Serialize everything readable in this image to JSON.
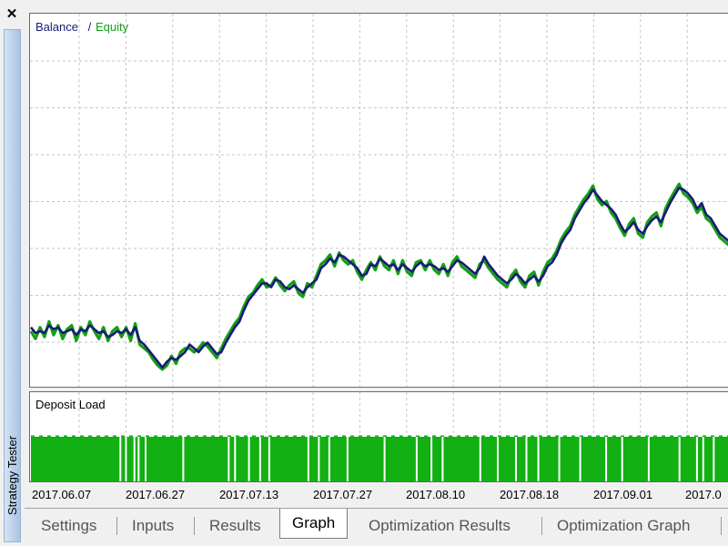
{
  "window": {
    "close_glyph": "✕",
    "side_title": "Strategy Tester"
  },
  "tabs": [
    {
      "label": "Settings",
      "active": false
    },
    {
      "label": "Inputs",
      "active": false
    },
    {
      "label": "Results",
      "active": false
    },
    {
      "label": "Graph",
      "active": true
    },
    {
      "label": "Optimization Results",
      "active": false
    },
    {
      "label": "Optimization Graph",
      "active": false
    }
  ],
  "chart_data": [
    {
      "type": "line",
      "panel": "main",
      "legend": {
        "balance_label": "Balance",
        "separator": " / ",
        "equity_label": "Equity",
        "placement": "top-left"
      },
      "grid": true,
      "colors": {
        "balance": "#1a1a7a",
        "equity": "#12a012",
        "grid": "#c6c6c6",
        "background": "#ffffff"
      },
      "series": [
        {
          "name": "Balance",
          "values": [
            0.23,
            0.2,
            0.21,
            0.2,
            0.24,
            0.22,
            0.23,
            0.2,
            0.21,
            0.22,
            0.19,
            0.22,
            0.21,
            0.24,
            0.22,
            0.2,
            0.21,
            0.18,
            0.19,
            0.21,
            0.2,
            0.22,
            0.19,
            0.23,
            0.16,
            0.14,
            0.11,
            0.08,
            0.05,
            0.02,
            0.05,
            0.07,
            0.06,
            0.08,
            0.1,
            0.14,
            0.12,
            0.1,
            0.13,
            0.15,
            0.12,
            0.09,
            0.1,
            0.15,
            0.19,
            0.23,
            0.26,
            0.32,
            0.37,
            0.4,
            0.43,
            0.46,
            0.46,
            0.44,
            0.48,
            0.47,
            0.44,
            0.43,
            0.45,
            0.43,
            0.41,
            0.44,
            0.46,
            0.48,
            0.54,
            0.56,
            0.59,
            0.57,
            0.61,
            0.6,
            0.58,
            0.56,
            0.54,
            0.5,
            0.51,
            0.56,
            0.55,
            0.59,
            0.57,
            0.55,
            0.56,
            0.53,
            0.56,
            0.54,
            0.52,
            0.55,
            0.57,
            0.55,
            0.56,
            0.55,
            0.53,
            0.54,
            0.52,
            0.55,
            0.58,
            0.57,
            0.55,
            0.53,
            0.51,
            0.54,
            0.6,
            0.56,
            0.53,
            0.5,
            0.48,
            0.46,
            0.48,
            0.51,
            0.49,
            0.46,
            0.48,
            0.5,
            0.47,
            0.5,
            0.55,
            0.57,
            0.61,
            0.67,
            0.71,
            0.74,
            0.8,
            0.84,
            0.88,
            0.91,
            0.95,
            0.92,
            0.89,
            0.87,
            0.85,
            0.82,
            0.77,
            0.73,
            0.75,
            0.78,
            0.74,
            0.72,
            0.76,
            0.79,
            0.81,
            0.78,
            0.83,
            0.88,
            0.92,
            0.96,
            0.95,
            0.93,
            0.9,
            0.85,
            0.88,
            0.82,
            0.8,
            0.76,
            0.72,
            0.7,
            0.68
          ]
        },
        {
          "name": "Equity",
          "values": [
            0.21,
            0.17,
            0.23,
            0.18,
            0.26,
            0.19,
            0.24,
            0.17,
            0.22,
            0.24,
            0.16,
            0.23,
            0.19,
            0.26,
            0.21,
            0.17,
            0.23,
            0.16,
            0.21,
            0.23,
            0.18,
            0.23,
            0.16,
            0.25,
            0.14,
            0.12,
            0.1,
            0.06,
            0.03,
            0.01,
            0.03,
            0.08,
            0.04,
            0.1,
            0.12,
            0.12,
            0.1,
            0.12,
            0.15,
            0.13,
            0.1,
            0.07,
            0.12,
            0.17,
            0.21,
            0.25,
            0.28,
            0.34,
            0.39,
            0.41,
            0.45,
            0.48,
            0.44,
            0.45,
            0.49,
            0.45,
            0.42,
            0.45,
            0.47,
            0.41,
            0.39,
            0.46,
            0.44,
            0.5,
            0.56,
            0.58,
            0.61,
            0.55,
            0.62,
            0.58,
            0.56,
            0.58,
            0.52,
            0.48,
            0.53,
            0.57,
            0.53,
            0.6,
            0.55,
            0.53,
            0.58,
            0.51,
            0.58,
            0.52,
            0.5,
            0.57,
            0.58,
            0.53,
            0.58,
            0.53,
            0.51,
            0.56,
            0.5,
            0.57,
            0.6,
            0.55,
            0.53,
            0.51,
            0.49,
            0.56,
            0.58,
            0.54,
            0.51,
            0.48,
            0.46,
            0.44,
            0.5,
            0.53,
            0.47,
            0.44,
            0.5,
            0.52,
            0.45,
            0.52,
            0.57,
            0.59,
            0.63,
            0.69,
            0.73,
            0.76,
            0.82,
            0.86,
            0.9,
            0.93,
            0.97,
            0.9,
            0.87,
            0.89,
            0.83,
            0.8,
            0.75,
            0.71,
            0.77,
            0.8,
            0.72,
            0.7,
            0.78,
            0.81,
            0.83,
            0.76,
            0.85,
            0.9,
            0.94,
            0.98,
            0.93,
            0.91,
            0.88,
            0.83,
            0.86,
            0.8,
            0.78,
            0.74,
            0.7,
            0.68,
            0.66
          ]
        }
      ]
    },
    {
      "type": "bar",
      "panel": "deposit_load",
      "title": "Deposit Load",
      "grid": true,
      "colors": {
        "bars": "#12b012",
        "gap": "#ffffff"
      },
      "gap_fractions": [
        0.128,
        0.136,
        0.148,
        0.154,
        0.164,
        0.218,
        0.283,
        0.292,
        0.312,
        0.328,
        0.341,
        0.397,
        0.412,
        0.427,
        0.453,
        0.506,
        0.552,
        0.573,
        0.589,
        0.643,
        0.668,
        0.694,
        0.709,
        0.726,
        0.756,
        0.786,
        0.823,
        0.846,
        0.884,
        0.928,
        0.953,
        0.962,
        0.977
      ]
    }
  ],
  "x_axis": {
    "tick_labels": [
      "2017.06.07",
      "2017.06.27",
      "2017.07.13",
      "2017.07.27",
      "2017.08.10",
      "2017.08.18",
      "2017.09.01",
      "2017.0"
    ]
  }
}
